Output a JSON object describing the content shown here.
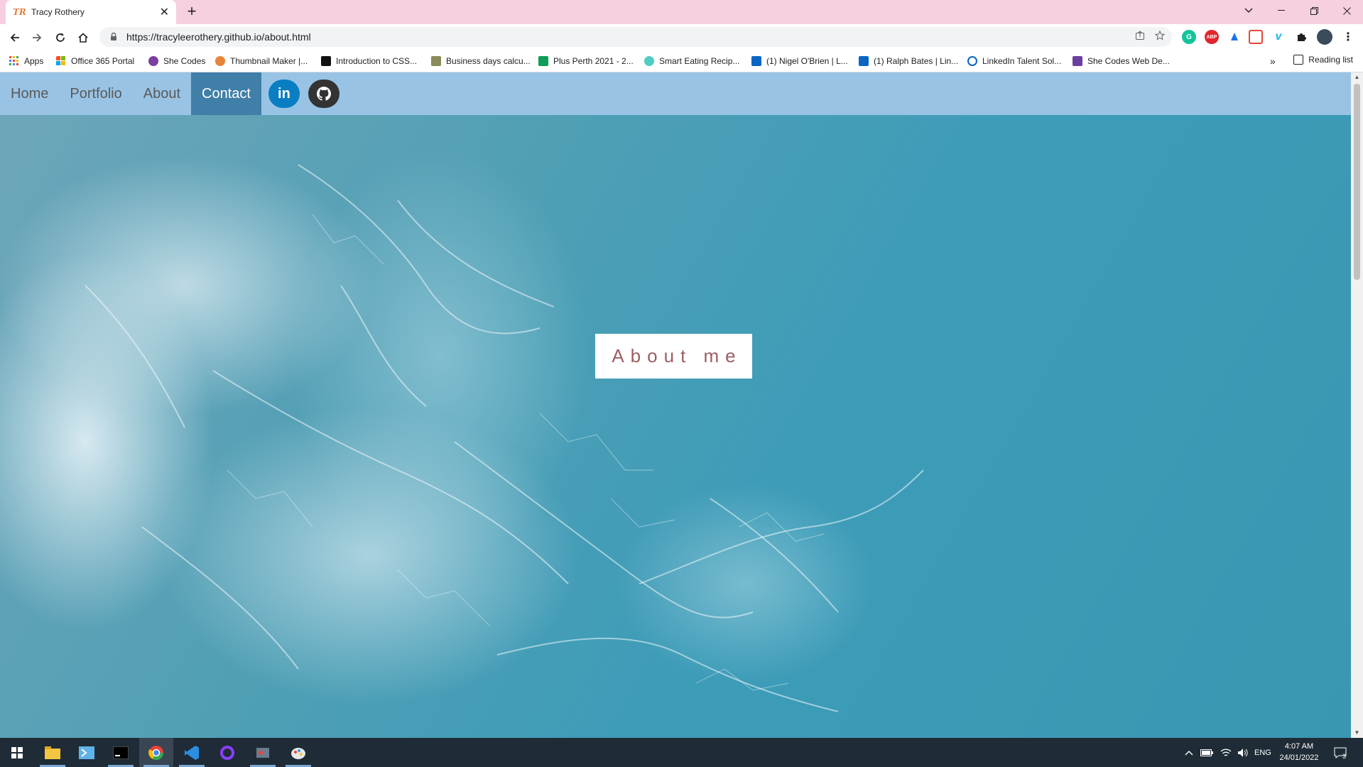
{
  "browser": {
    "tab_title": "Tracy Rothery",
    "tab_favicon": "TR",
    "url": "https://tracyleerothery.github.io/about.html",
    "reading_list": "Reading list",
    "more_bookmarks": "»"
  },
  "bookmarks": [
    {
      "label": "Apps",
      "color": "#ea4335"
    },
    {
      "label": "Office 365 Portal",
      "color": "#f25022"
    },
    {
      "label": "She Codes",
      "color": "#7b3fa0"
    },
    {
      "label": "Thumbnail Maker |...",
      "color": "#e8833a"
    },
    {
      "label": "Introduction to CSS...",
      "color": "#111111"
    },
    {
      "label": "Business days calcu...",
      "color": "#8a8a5a"
    },
    {
      "label": "Plus Perth 2021 - 2...",
      "color": "#0f9d58"
    },
    {
      "label": "Smart Eating Recip...",
      "color": "#4ecdc4"
    },
    {
      "label": "(1) Nigel O'Brien | L...",
      "color": "#0a66c2"
    },
    {
      "label": "(1) Ralph Bates | Lin...",
      "color": "#0a66c2"
    },
    {
      "label": "LinkedIn Talent Sol...",
      "color": "#0a66c2"
    },
    {
      "label": "She Codes Web De...",
      "color": "#6b3fa0"
    }
  ],
  "nav": {
    "items": [
      {
        "label": "Home"
      },
      {
        "label": "Portfolio"
      },
      {
        "label": "About"
      },
      {
        "label": "Contact"
      }
    ],
    "linkedin_label": "in"
  },
  "hero": {
    "heading": "About me"
  },
  "taskbar": {
    "lang": "ENG",
    "time": "4:07 AM",
    "date": "24/01/2022",
    "notifications": "3"
  },
  "colors": {
    "nav_bg": "#99c3e4",
    "nav_active": "#3f7fa8",
    "heading_text": "#9a5e62",
    "tab_strip": "#f6cfe0"
  }
}
